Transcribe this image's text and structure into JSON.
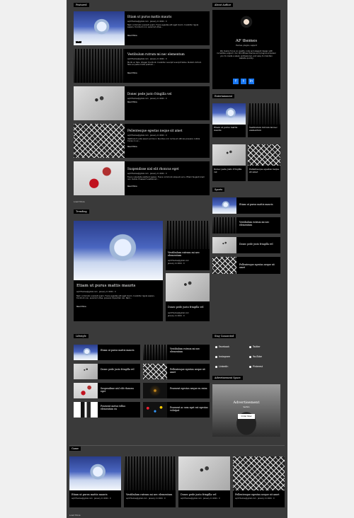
{
  "featured": {
    "label": "Featured",
    "posts": [
      {
        "title": "Etiam ut purus mattis mauris",
        "author": "aqmThemes@gmail.com",
        "date": "January 11 2024",
        "comments": "0",
        "excerpt": "Nam commodo suscipit quam. Fusce egestas elit eget lorem. Curabitur ligula sapien, tincidunt non, euismod vitae...",
        "more": "Read More"
      },
      {
        "title": "Vestibulum rutrum mi nec elementum",
        "author": "aqmThemes@gmail.com",
        "date": "January 11 2024",
        "comments": "0",
        "excerpt": "Morbi ac felis. Integer tincidunt. Curabitur suscipit suscipit tellus. Nullam dictum felis eu pede mollis pretium...",
        "more": "Read More"
      },
      {
        "title": "Donec pede justo fringilla vel",
        "author": "aqmThemes@gmail.com",
        "date": "January 11 2024",
        "comments": "0",
        "excerpt": "",
        "more": "Read More"
      },
      {
        "title": "Pellentesque egestas neque sit amet",
        "author": "aqmThemes@gmail.com",
        "date": "January 11 2024",
        "comments": "0",
        "excerpt": "Vestibulum ante ipsum primis in faucibus orci luctus et ultrices posuere cubilia Curae; In ac...",
        "more": "Read More"
      },
      {
        "title": "Suspendisse nisl elit rhoncus eget",
        "author": "aqmThemes@gmail.com",
        "date": "January 11 2024",
        "comments": "0",
        "excerpt": "Fusce vulputate eleifend sapien. Fusce commodo aliquam arcu. Etiam feugiat lorem non metus. Praesent vestibulum...",
        "more": "Read More"
      }
    ],
    "load_more": "Load More"
  },
  "trending": {
    "label": "Trending",
    "main": {
      "title": "Etiam ut purus mattis mauris",
      "author": "aqmThemes@gmail.com",
      "date": "January 11 2024",
      "comments": "0",
      "excerpt": "Nam commodo suscipit quam. Fusce egestas elit eget lorem. Curabitur ligula sapien, tincidunt non, euismod vitae, posuere imperdiet, leo. Nam...",
      "more": "Read More"
    },
    "side": [
      {
        "title": "Vestibulum rutrum mi nec elementum",
        "author": "aqmThemes@gmail.com",
        "date": "January 11 2024",
        "comments": "0"
      },
      {
        "title": "Donec pede justo fringilla vel",
        "author": "aqmThemes@gmail.com",
        "date": "January 11 2024",
        "comments": "0"
      }
    ]
  },
  "lifestyle": {
    "label": "Lifestyle",
    "items": [
      {
        "title": "Etiam ut purus mattis mauris"
      },
      {
        "title": "Vestibulum rutrum mi nec elementum"
      },
      {
        "title": "Donec pede justo fringilla vel"
      },
      {
        "title": "Pellentesque egestas neque sit amet"
      },
      {
        "title": "Suspendisse nisl elit rhoncus eget"
      },
      {
        "title": "Praesent egestas neque eu enim"
      },
      {
        "title": "Praesent metus tellus elementum eu"
      },
      {
        "title": "Praesent ac sem eget est egestas volutpat"
      }
    ]
  },
  "games": {
    "label": "Game",
    "items": [
      {
        "title": "Etiam ut purus mattis mauris",
        "author": "aqmThemes@gmail.com",
        "date": "January 11 2024",
        "comments": "0"
      },
      {
        "title": "Vestibulum rutrum mi nec elementum",
        "author": "aqmThemes@gmail.com",
        "date": "January 11 2024",
        "comments": "0"
      },
      {
        "title": "Donec pede justo fringilla vel",
        "author": "aqmThemes@gmail.com",
        "date": "January 11 2024",
        "comments": "0"
      },
      {
        "title": "Pellentesque egestas neque sit amet",
        "author": "aqmThemes@gmail.com",
        "date": "January 11 2024",
        "comments": "0"
      }
    ],
    "load_more": "Load More"
  },
  "sidebar": {
    "about": {
      "label": "About Author",
      "name": "AF themes",
      "tagline": "themes, plugins, support",
      "bio": "We mainly focus on quality code and elegant design with incredible support. Our WordPress themes and plugins empower you to create a sleek, professional, and easy to maintain website quickly."
    },
    "entertainment": {
      "label": "Entertainment",
      "items": [
        {
          "title": "Etiam ut purus mattis mauris"
        },
        {
          "title": "Vestibulum rutrum mi nec elementum"
        },
        {
          "title": "Donec pede justo fringilla vel"
        },
        {
          "title": "Pellentesque egestas neque sit amet"
        }
      ]
    },
    "sports": {
      "label": "Sports",
      "items": [
        {
          "title": "Etiam ut purus mattis mauris"
        },
        {
          "title": "Vestibulum rutrum mi nec elementum"
        },
        {
          "title": "Donec pede justo fringilla vel"
        },
        {
          "title": "Pellentesque egestas neque sit amet"
        }
      ]
    },
    "connected": {
      "label": "Stay Connected",
      "links": [
        "Facebook",
        "Twitter",
        "Instagram",
        "YouTube",
        "LinkedIn",
        "Pinterest"
      ]
    },
    "ad": {
      "label": "Advertisement Space",
      "title": "Advertisement",
      "subtitle": "Section",
      "button": "Order Now"
    }
  },
  "colors": {
    "page_bg": "#3a3a3a",
    "outer_bg": "#f0f0f0",
    "card_bg": "#000000",
    "social_blue": "#1877f2"
  }
}
